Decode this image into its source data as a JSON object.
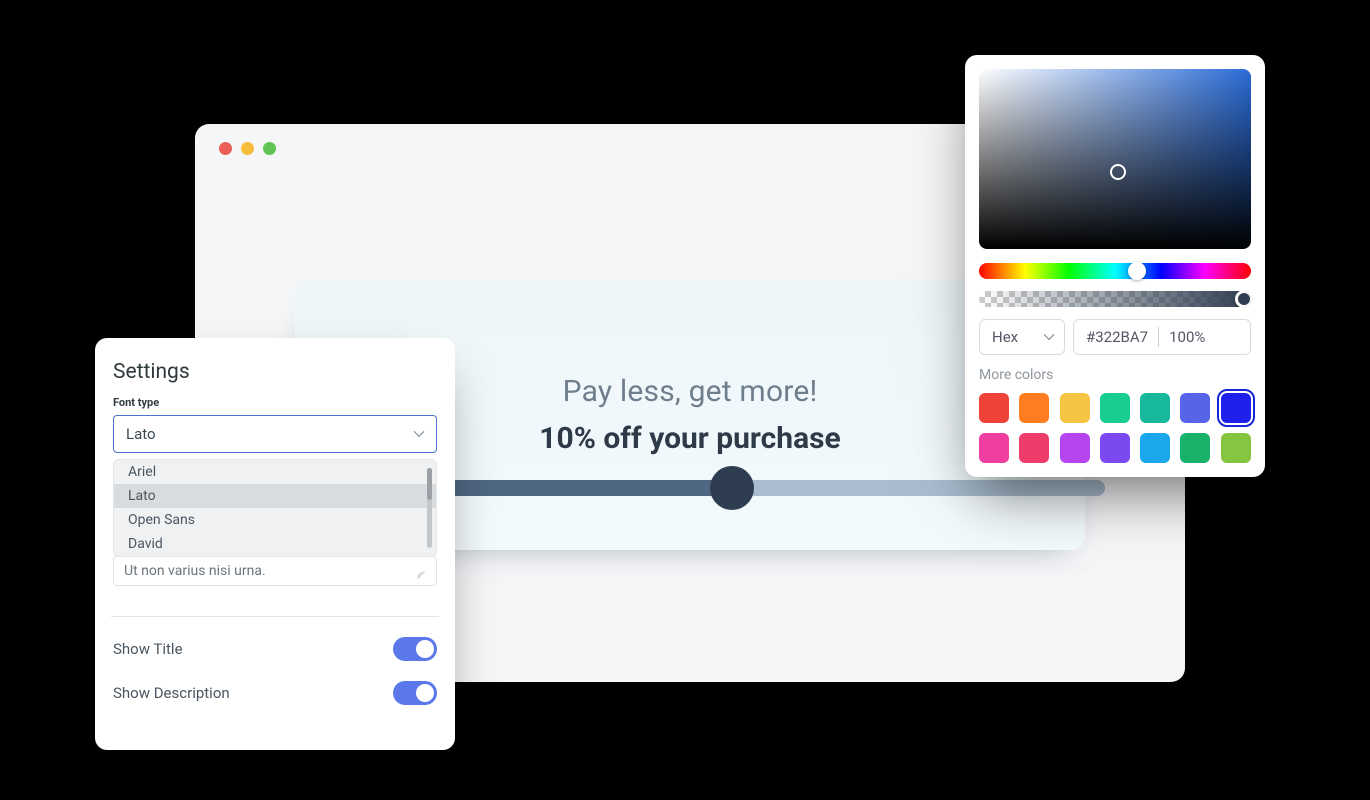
{
  "browser": {
    "card_title": "Pay less, get more!",
    "card_subtitle": "10% off your purchase",
    "progress_percent": 55
  },
  "settings": {
    "title": "Settings",
    "font_type_label": "Font type",
    "font_selected": "Lato",
    "font_options": [
      "Ariel",
      "Lato",
      "Open Sans",
      "David"
    ],
    "sample_text": "Ut non varius nisi urna.",
    "show_title_label": "Show Title",
    "show_title_on": true,
    "show_description_label": "Show Description",
    "show_description_on": true
  },
  "color_picker": {
    "format_label": "Hex",
    "hex_value": "#322BA7",
    "opacity_text": "100%",
    "more_colors_label": "More colors",
    "selected_swatch_index": 6,
    "swatches": [
      "#f04337",
      "#ff7c1f",
      "#f6c445",
      "#19cc8f",
      "#18b89c",
      "#5664e9",
      "#1f1fe9",
      "#ef3da0",
      "#ef3d6b",
      "#b645f0",
      "#7a4af0",
      "#1aa7eb",
      "#18b26b",
      "#86c540"
    ]
  }
}
